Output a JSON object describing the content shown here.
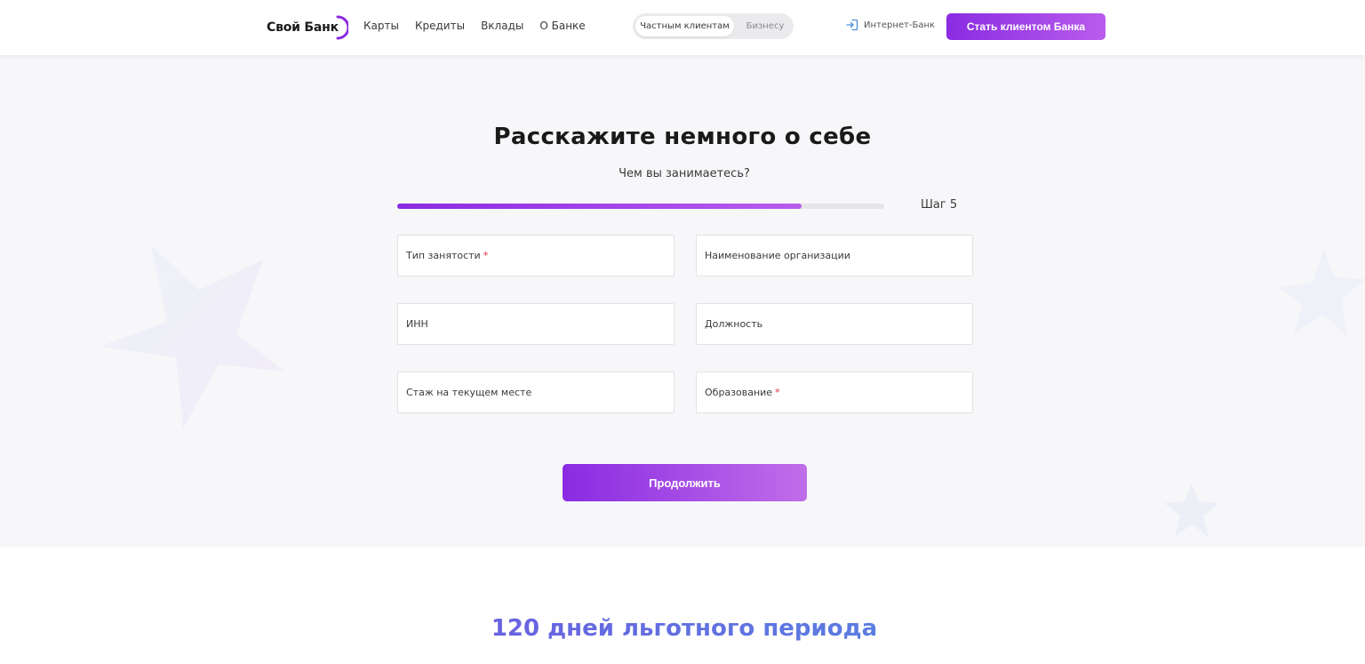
{
  "header": {
    "logo_text": "Свой Банк",
    "nav": [
      "Карты",
      "Кредиты",
      "Вклады",
      "О Банке"
    ],
    "segment": {
      "active": "Частным клиентам",
      "inactive": "Бизнесу"
    },
    "internet_bank": "Интернет-Банк",
    "cta": "Стать клиентом Банка"
  },
  "form": {
    "title": "Расскажите немного о себе",
    "subtitle": "Чем вы занимаетесь?",
    "step_label": "Шаг 5",
    "progress": 0.83,
    "fields": [
      {
        "label": "Тип занятости",
        "required": true
      },
      {
        "label": "Наименование организации",
        "required": false
      },
      {
        "label": "ИНН",
        "required": false
      },
      {
        "label": "Должность",
        "required": false
      },
      {
        "label": "Стаж на текущем месте",
        "required": false
      },
      {
        "label": "Образование",
        "required": true
      }
    ],
    "required_mark": "*",
    "submit": "Продолжить"
  },
  "promo": {
    "headline": "120 дней льготного периода"
  },
  "colors": {
    "accent_start": "#8a2be2",
    "accent_end": "#b95cec",
    "required": "#e0333a",
    "section_bg": "#f7f7fa"
  }
}
